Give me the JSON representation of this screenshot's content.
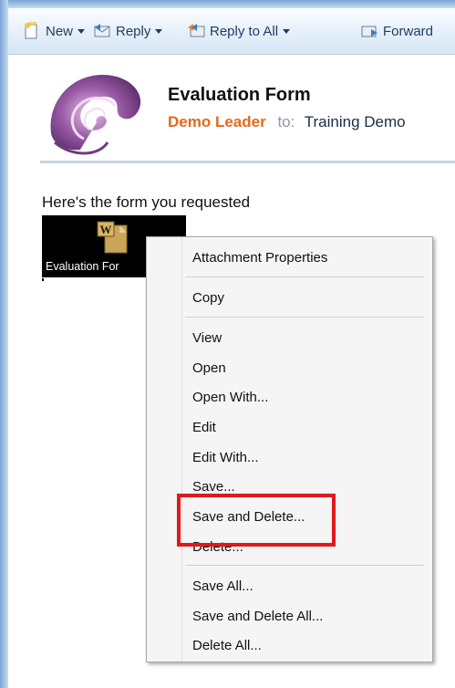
{
  "toolbar": {
    "new_label": "New",
    "reply_label": "Reply",
    "reply_all_label": "Reply to All",
    "forward_label": "Forward"
  },
  "message": {
    "subject": "Evaluation Form",
    "from": "Demo Leader",
    "to_label": "to:",
    "to": "Training Demo",
    "body": "Here's the form you requested"
  },
  "attachment": {
    "label": "Evaluation For"
  },
  "context_menu": {
    "attachment_properties": "Attachment Properties",
    "copy": "Copy",
    "view": "View",
    "open": "Open",
    "open_with": "Open With...",
    "edit": "Edit",
    "edit_with": "Edit With...",
    "save": "Save...",
    "save_and_delete": "Save and Delete...",
    "delete": "Delete...",
    "save_all": "Save All...",
    "save_and_delete_all": "Save and Delete All...",
    "delete_all": "Delete All..."
  },
  "colors": {
    "from_name": "#e26a1b",
    "highlight_box": "#e0191c",
    "toolbar_text": "#1f3d66"
  }
}
